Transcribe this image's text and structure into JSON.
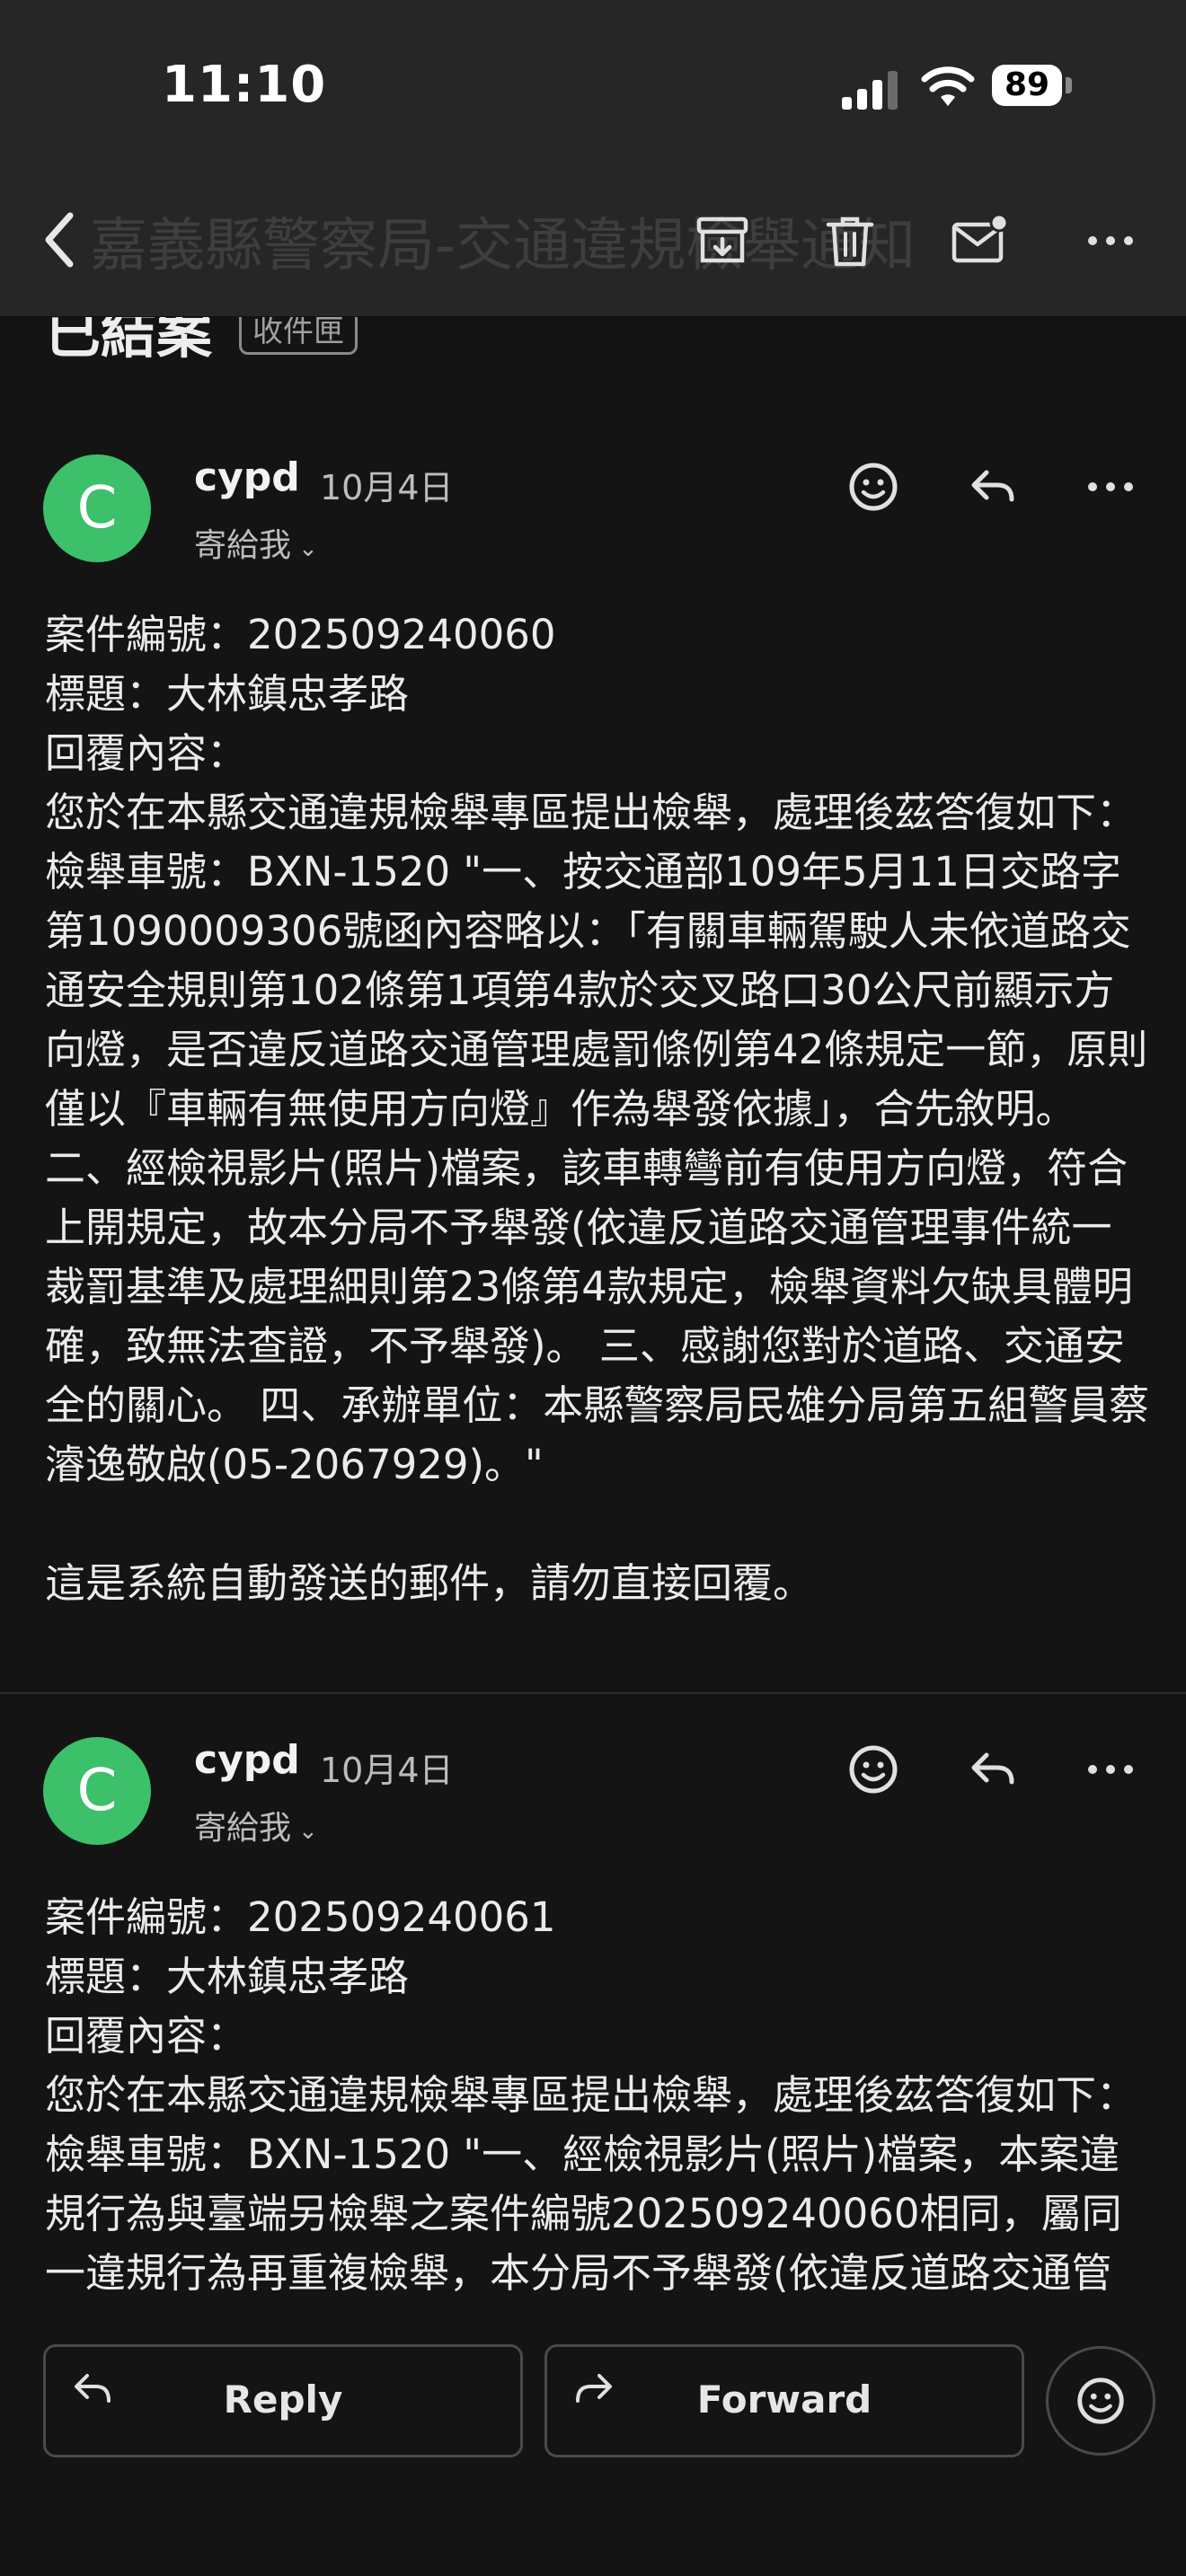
{
  "status_bar": {
    "time": "11:10",
    "battery": "89"
  },
  "header": {
    "ghost_subject": "嘉義縣警察局-交通違規檢舉通知"
  },
  "subject": {
    "text": "已結案",
    "label": "收件匣"
  },
  "messages": [
    {
      "avatar_letter": "C",
      "sender": "cypd",
      "date": "10月4日",
      "recipient": "寄給我",
      "body": "案件編號：202509240060\n標題：大林鎮忠孝路\n回覆內容：\n您於在本縣交通違規檢舉專區提出檢舉，處理後茲答復如下： 檢舉車號：BXN-1520 \"一、按交通部109年5月11日交路字第1090009306號函內容略以：「有關車輛駕駛人未依道路交通安全規則第102條第1項第4款於交叉路口30公尺前顯示方向燈，是否違反道路交通管理處罰條例第42條規定一節，原則僅以『車輛有無使用方向燈』作為舉發依據」，合先敘明。 二、經檢視影片(照片)檔案，該車轉彎前有使用方向燈，符合上開規定，故本分局不予舉發(依違反道路交通管理事件統一裁罰基準及處理細則第23條第4款規定，檢舉資料欠缺具體明確，致無法查證，不予舉發)。 三、感謝您對於道路、交通安全的關心。 四、承辦單位：本縣警察局民雄分局第五組警員蔡濬逸敬啟(05-2067929)。\"\n\n這是系統自動發送的郵件，請勿直接回覆。"
    },
    {
      "avatar_letter": "C",
      "sender": "cypd",
      "date": "10月4日",
      "recipient": "寄給我",
      "body": "案件編號：202509240061\n標題：大林鎮忠孝路\n回覆內容：\n您於在本縣交通違規檢舉專區提出檢舉，處理後茲答復如下： 檢舉車號：BXN-1520 \"一、經檢視影片(照片)檔案，本案違規行為與臺端另檢舉之案件編號202509240060相同，屬同一違規行為再重複檢舉，本分局不予舉發(依違反道路交通管理事件統一裁罰基"
    }
  ],
  "actions": {
    "reply": "Reply",
    "forward": "Forward"
  }
}
